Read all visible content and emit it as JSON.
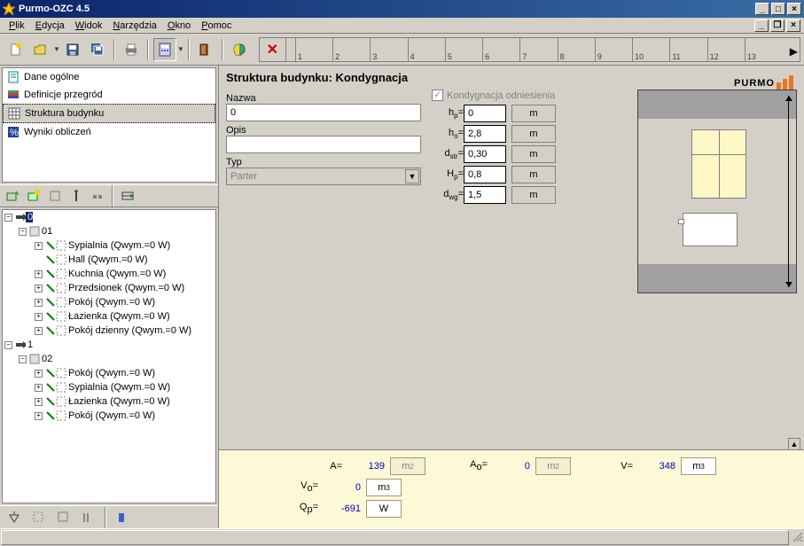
{
  "app": {
    "title": "Purmo-OZC 4.5"
  },
  "menu": [
    "Plik",
    "Edycja",
    "Widok",
    "Narzędzia",
    "Okno",
    "Pomoc"
  ],
  "ruler_numbers": [
    "1",
    "2",
    "3",
    "4",
    "5",
    "6",
    "7",
    "8",
    "9",
    "10",
    "11",
    "12",
    "13"
  ],
  "nav": [
    {
      "icon": "doc-icon",
      "label": "Dane ogólne"
    },
    {
      "icon": "layers-icon",
      "label": "Definicje przegród"
    },
    {
      "icon": "grid-icon",
      "label": "Struktura budynku",
      "selected": true
    },
    {
      "icon": "results-icon",
      "label": "Wyniki obliczeń"
    }
  ],
  "tree": {
    "root": "0",
    "floor1": "01",
    "floor1_rooms": [
      "Sypialnia (Qwym.=0 W)",
      "Hall (Qwym.=0 W)",
      "Kuchnia (Qwym.=0 W)",
      "Przedsionek (Qwym.=0 W)",
      "Pokój (Qwym.=0 W)",
      "Łazienka (Qwym.=0 W)",
      "Pokój dzienny (Qwym.=0 W)"
    ],
    "level2": "1",
    "floor2": "02",
    "floor2_rooms": [
      "Pokój (Qwym.=0 W)",
      "Sypialnia (Qwym.=0 W)",
      "Łazienka (Qwym.=0 W)",
      "Pokój (Qwym.=0 W)"
    ]
  },
  "panel": {
    "title": "Struktura budynku: Kondygnacja",
    "logo": "PURMO",
    "name_label": "Nazwa",
    "name_value": "0",
    "desc_label": "Opis",
    "desc_value": "",
    "type_label": "Typ",
    "type_value": "Parter",
    "ref_floor": "Kondygnacja odniesienia",
    "params": {
      "hp": {
        "label": "h",
        "sub": "p",
        "value": "0",
        "unit": "m"
      },
      "ho": {
        "label": "h",
        "sub": "o",
        "value": "2,8",
        "unit": "m"
      },
      "dstr": {
        "label": "d",
        "sub": "str",
        "value": "0,30",
        "unit": "m"
      },
      "Hp": {
        "label": "H",
        "sub": "p",
        "value": "0,8",
        "unit": "m"
      },
      "dwg": {
        "label": "d",
        "sub": "wg",
        "value": "1,5",
        "unit": "m"
      }
    }
  },
  "results": {
    "A": {
      "label": "A=",
      "value": "139",
      "unit": "m²"
    },
    "Ao": {
      "label": "A",
      "sub": "o",
      "eq": "=",
      "value": "0",
      "unit": "m²"
    },
    "V": {
      "label": "V=",
      "value": "348",
      "unit": "m³"
    },
    "Vo": {
      "label": "V",
      "sub": "o",
      "eq": "=",
      "value": "0",
      "unit": "m³"
    },
    "Qp": {
      "label": "Q",
      "sub": "p",
      "eq": "=",
      "value": "-691",
      "unit": "W"
    }
  }
}
